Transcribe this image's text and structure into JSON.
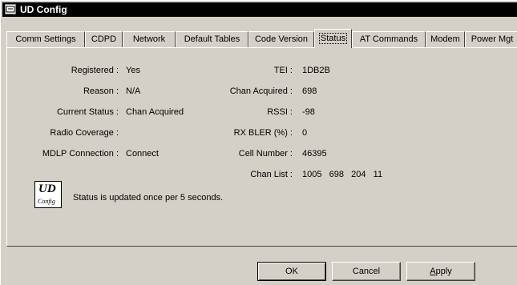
{
  "window": {
    "title": "UD Config"
  },
  "tabs": [
    {
      "label": "Comm Settings"
    },
    {
      "label": "CDPD"
    },
    {
      "label": "Network"
    },
    {
      "label": "Default Tables"
    },
    {
      "label": "Code Version"
    },
    {
      "label": "Status"
    },
    {
      "label": "AT Commands"
    },
    {
      "label": "Modem"
    },
    {
      "label": "Power Mgt"
    }
  ],
  "active_tab": "Status",
  "status": {
    "left": [
      {
        "label": "Registered :",
        "value": "Yes"
      },
      {
        "label": "Reason :",
        "value": "N/A"
      },
      {
        "label": "Current Status :",
        "value": "Chan Acquired"
      },
      {
        "label": "Radio Coverage :",
        "value": ""
      },
      {
        "label": "MDLP Connection :",
        "value": "Connect"
      }
    ],
    "right": [
      {
        "label": "TEI :",
        "value": "1DB2B"
      },
      {
        "label": "Chan Acquired :",
        "value": "698"
      },
      {
        "label": "RSSI :",
        "value": "-98"
      },
      {
        "label": "RX BLER (%) :",
        "value": "0"
      },
      {
        "label": "Cell Number :",
        "value": "46395"
      },
      {
        "label": "Chan List :",
        "value": "1005   698   204   11"
      }
    ]
  },
  "logo": {
    "big": "UD",
    "small": "Config"
  },
  "note": "Status is updated once per 5 seconds.",
  "buttons": {
    "ok": "OK",
    "cancel": "Cancel",
    "apply_prefix": "",
    "apply_underlined": "A",
    "apply_rest": "pply"
  }
}
